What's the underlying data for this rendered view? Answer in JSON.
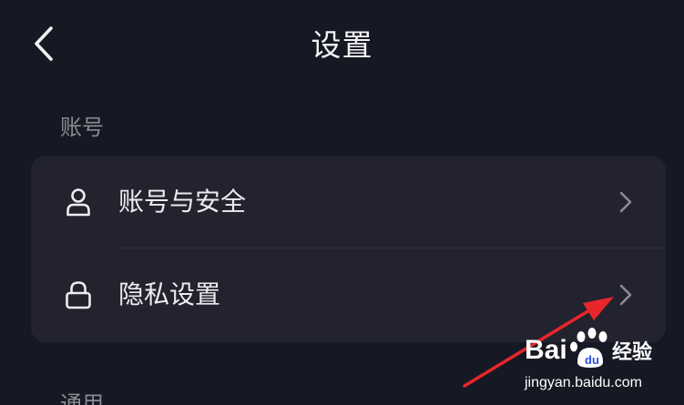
{
  "header": {
    "title": "设置",
    "back_icon": "chevron-left-icon"
  },
  "sections": [
    {
      "label": "账号",
      "items": [
        {
          "label": "账号与安全",
          "icon": "user-icon"
        },
        {
          "label": "隐私设置",
          "icon": "lock-icon"
        }
      ]
    },
    {
      "label": "通用"
    }
  ],
  "watermark": {
    "brand": "Bai du 经验",
    "url": "jingyan.baidu.com"
  },
  "colors": {
    "background": "#161823",
    "card": "#22232e",
    "annotation_arrow": "#e8262b"
  }
}
